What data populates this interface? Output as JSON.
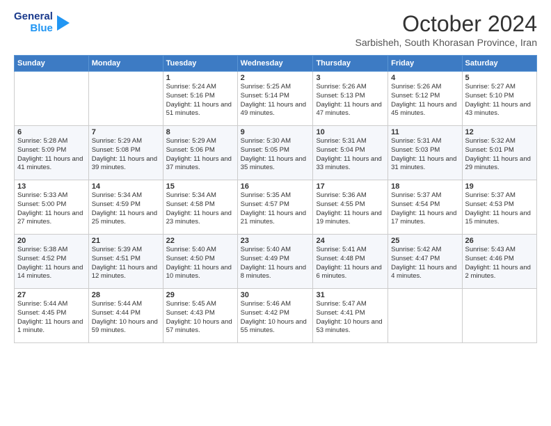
{
  "header": {
    "logo_general": "General",
    "logo_blue": "Blue",
    "month_title": "October 2024",
    "subtitle": "Sarbisheh, South Khorasan Province, Iran"
  },
  "days_of_week": [
    "Sunday",
    "Monday",
    "Tuesday",
    "Wednesday",
    "Thursday",
    "Friday",
    "Saturday"
  ],
  "weeks": [
    [
      {
        "day": "",
        "sunrise": "",
        "sunset": "",
        "daylight": ""
      },
      {
        "day": "",
        "sunrise": "",
        "sunset": "",
        "daylight": ""
      },
      {
        "day": "1",
        "sunrise": "Sunrise: 5:24 AM",
        "sunset": "Sunset: 5:16 PM",
        "daylight": "Daylight: 11 hours and 51 minutes."
      },
      {
        "day": "2",
        "sunrise": "Sunrise: 5:25 AM",
        "sunset": "Sunset: 5:14 PM",
        "daylight": "Daylight: 11 hours and 49 minutes."
      },
      {
        "day": "3",
        "sunrise": "Sunrise: 5:26 AM",
        "sunset": "Sunset: 5:13 PM",
        "daylight": "Daylight: 11 hours and 47 minutes."
      },
      {
        "day": "4",
        "sunrise": "Sunrise: 5:26 AM",
        "sunset": "Sunset: 5:12 PM",
        "daylight": "Daylight: 11 hours and 45 minutes."
      },
      {
        "day": "5",
        "sunrise": "Sunrise: 5:27 AM",
        "sunset": "Sunset: 5:10 PM",
        "daylight": "Daylight: 11 hours and 43 minutes."
      }
    ],
    [
      {
        "day": "6",
        "sunrise": "Sunrise: 5:28 AM",
        "sunset": "Sunset: 5:09 PM",
        "daylight": "Daylight: 11 hours and 41 minutes."
      },
      {
        "day": "7",
        "sunrise": "Sunrise: 5:29 AM",
        "sunset": "Sunset: 5:08 PM",
        "daylight": "Daylight: 11 hours and 39 minutes."
      },
      {
        "day": "8",
        "sunrise": "Sunrise: 5:29 AM",
        "sunset": "Sunset: 5:06 PM",
        "daylight": "Daylight: 11 hours and 37 minutes."
      },
      {
        "day": "9",
        "sunrise": "Sunrise: 5:30 AM",
        "sunset": "Sunset: 5:05 PM",
        "daylight": "Daylight: 11 hours and 35 minutes."
      },
      {
        "day": "10",
        "sunrise": "Sunrise: 5:31 AM",
        "sunset": "Sunset: 5:04 PM",
        "daylight": "Daylight: 11 hours and 33 minutes."
      },
      {
        "day": "11",
        "sunrise": "Sunrise: 5:31 AM",
        "sunset": "Sunset: 5:03 PM",
        "daylight": "Daylight: 11 hours and 31 minutes."
      },
      {
        "day": "12",
        "sunrise": "Sunrise: 5:32 AM",
        "sunset": "Sunset: 5:01 PM",
        "daylight": "Daylight: 11 hours and 29 minutes."
      }
    ],
    [
      {
        "day": "13",
        "sunrise": "Sunrise: 5:33 AM",
        "sunset": "Sunset: 5:00 PM",
        "daylight": "Daylight: 11 hours and 27 minutes."
      },
      {
        "day": "14",
        "sunrise": "Sunrise: 5:34 AM",
        "sunset": "Sunset: 4:59 PM",
        "daylight": "Daylight: 11 hours and 25 minutes."
      },
      {
        "day": "15",
        "sunrise": "Sunrise: 5:34 AM",
        "sunset": "Sunset: 4:58 PM",
        "daylight": "Daylight: 11 hours and 23 minutes."
      },
      {
        "day": "16",
        "sunrise": "Sunrise: 5:35 AM",
        "sunset": "Sunset: 4:57 PM",
        "daylight": "Daylight: 11 hours and 21 minutes."
      },
      {
        "day": "17",
        "sunrise": "Sunrise: 5:36 AM",
        "sunset": "Sunset: 4:55 PM",
        "daylight": "Daylight: 11 hours and 19 minutes."
      },
      {
        "day": "18",
        "sunrise": "Sunrise: 5:37 AM",
        "sunset": "Sunset: 4:54 PM",
        "daylight": "Daylight: 11 hours and 17 minutes."
      },
      {
        "day": "19",
        "sunrise": "Sunrise: 5:37 AM",
        "sunset": "Sunset: 4:53 PM",
        "daylight": "Daylight: 11 hours and 15 minutes."
      }
    ],
    [
      {
        "day": "20",
        "sunrise": "Sunrise: 5:38 AM",
        "sunset": "Sunset: 4:52 PM",
        "daylight": "Daylight: 11 hours and 14 minutes."
      },
      {
        "day": "21",
        "sunrise": "Sunrise: 5:39 AM",
        "sunset": "Sunset: 4:51 PM",
        "daylight": "Daylight: 11 hours and 12 minutes."
      },
      {
        "day": "22",
        "sunrise": "Sunrise: 5:40 AM",
        "sunset": "Sunset: 4:50 PM",
        "daylight": "Daylight: 11 hours and 10 minutes."
      },
      {
        "day": "23",
        "sunrise": "Sunrise: 5:40 AM",
        "sunset": "Sunset: 4:49 PM",
        "daylight": "Daylight: 11 hours and 8 minutes."
      },
      {
        "day": "24",
        "sunrise": "Sunrise: 5:41 AM",
        "sunset": "Sunset: 4:48 PM",
        "daylight": "Daylight: 11 hours and 6 minutes."
      },
      {
        "day": "25",
        "sunrise": "Sunrise: 5:42 AM",
        "sunset": "Sunset: 4:47 PM",
        "daylight": "Daylight: 11 hours and 4 minutes."
      },
      {
        "day": "26",
        "sunrise": "Sunrise: 5:43 AM",
        "sunset": "Sunset: 4:46 PM",
        "daylight": "Daylight: 11 hours and 2 minutes."
      }
    ],
    [
      {
        "day": "27",
        "sunrise": "Sunrise: 5:44 AM",
        "sunset": "Sunset: 4:45 PM",
        "daylight": "Daylight: 11 hours and 1 minute."
      },
      {
        "day": "28",
        "sunrise": "Sunrise: 5:44 AM",
        "sunset": "Sunset: 4:44 PM",
        "daylight": "Daylight: 10 hours and 59 minutes."
      },
      {
        "day": "29",
        "sunrise": "Sunrise: 5:45 AM",
        "sunset": "Sunset: 4:43 PM",
        "daylight": "Daylight: 10 hours and 57 minutes."
      },
      {
        "day": "30",
        "sunrise": "Sunrise: 5:46 AM",
        "sunset": "Sunset: 4:42 PM",
        "daylight": "Daylight: 10 hours and 55 minutes."
      },
      {
        "day": "31",
        "sunrise": "Sunrise: 5:47 AM",
        "sunset": "Sunset: 4:41 PM",
        "daylight": "Daylight: 10 hours and 53 minutes."
      },
      {
        "day": "",
        "sunrise": "",
        "sunset": "",
        "daylight": ""
      },
      {
        "day": "",
        "sunrise": "",
        "sunset": "",
        "daylight": ""
      }
    ]
  ]
}
